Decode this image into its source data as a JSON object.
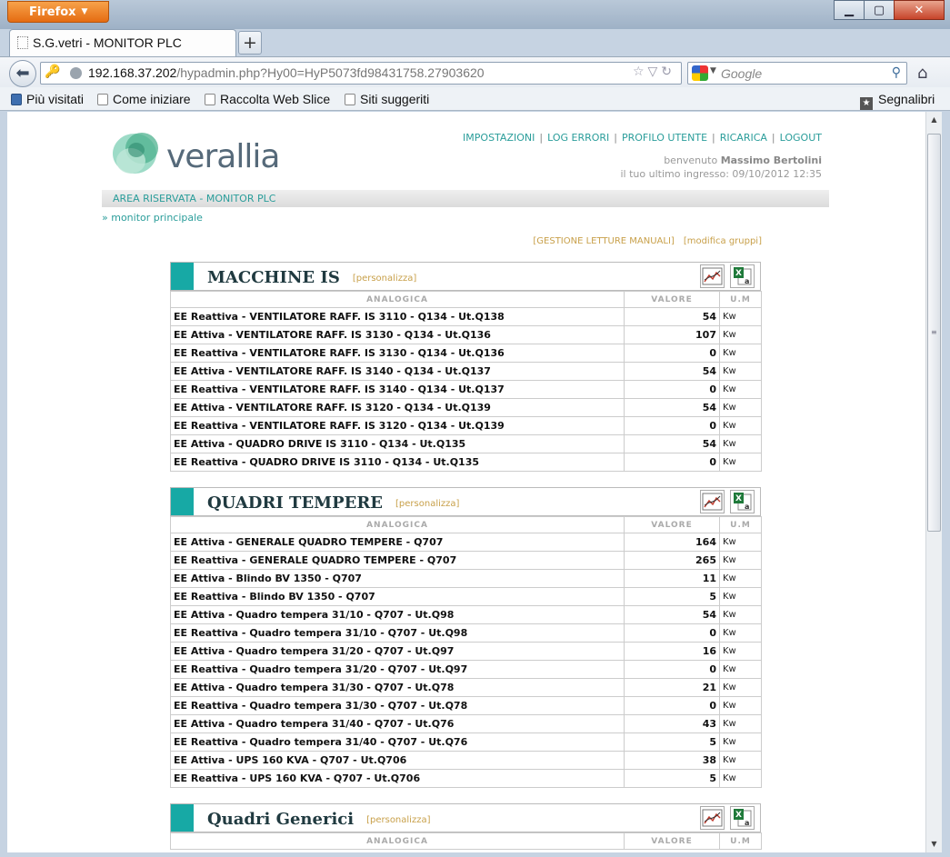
{
  "browser": {
    "menu_label": "Firefox",
    "tab_title": "S.G.vetri - MONITOR PLC",
    "url_host": "192.168.37.202",
    "url_path": "/hypadmin.php?Hy00=HyP5073fd98431758.27903620",
    "search_placeholder": "Google",
    "bookmarks": [
      "Più visitati",
      "Come iniziare",
      "Raccolta Web Slice",
      "Siti suggeriti"
    ],
    "bookmarks_menu": "Segnalibri"
  },
  "header": {
    "logo_text": "verallia",
    "links": [
      "IMPOSTAZIONI",
      "LOG ERRORI",
      "PROFILO UTENTE",
      "RICARICA",
      "LOGOUT"
    ],
    "welcome_prefix": "benvenuto",
    "user_name": "Massimo Bertolini",
    "last_login": "il tuo ultimo ingresso: 09/10/2012 12:35",
    "area_title": "AREA RISERVATA - MONITOR PLC",
    "breadcrumb": "» monitor principale"
  },
  "actions": {
    "manual_readings": "[GESTIONE LETTURE MANUALI]",
    "edit_groups": "[modifica gruppi]"
  },
  "table_headers": {
    "label": "ANALOGICA",
    "value": "VALORE",
    "unit": "U.M"
  },
  "sections": [
    {
      "title": "MACCHINE IS",
      "customize": "[personalizza]",
      "rows": [
        [
          "EE Reattiva - VENTILATORE RAFF. IS 3110 - Q134 - Ut.Q138",
          "54",
          "Kw"
        ],
        [
          "EE Attiva - VENTILATORE RAFF. IS 3130 - Q134 - Ut.Q136",
          "107",
          "Kw"
        ],
        [
          "EE Reattiva - VENTILATORE RAFF. IS 3130 - Q134 - Ut.Q136",
          "0",
          "Kw"
        ],
        [
          "EE Attiva - VENTILATORE RAFF. IS 3140 - Q134 - Ut.Q137",
          "54",
          "Kw"
        ],
        [
          "EE Reattiva - VENTILATORE RAFF. IS 3140 - Q134 - Ut.Q137",
          "0",
          "Kw"
        ],
        [
          "EE Attiva - VENTILATORE RAFF. IS 3120 - Q134 - Ut.Q139",
          "54",
          "Kw"
        ],
        [
          "EE Reattiva - VENTILATORE RAFF. IS 3120 - Q134 - Ut.Q139",
          "0",
          "Kw"
        ],
        [
          "EE Attiva - QUADRO DRIVE IS 3110 - Q134 - Ut.Q135",
          "54",
          "Kw"
        ],
        [
          "EE Reattiva - QUADRO DRIVE IS 3110 - Q134 - Ut.Q135",
          "0",
          "Kw"
        ]
      ]
    },
    {
      "title": "QUADRI TEMPERE",
      "customize": "[personalizza]",
      "rows": [
        [
          "EE Attiva - GENERALE QUADRO TEMPERE - Q707",
          "164",
          "Kw"
        ],
        [
          "EE Reattiva - GENERALE QUADRO TEMPERE - Q707",
          "265",
          "Kw"
        ],
        [
          "EE Attiva - Blindo BV 1350 - Q707",
          "11",
          "Kw"
        ],
        [
          "EE Reattiva - Blindo BV 1350 - Q707",
          "5",
          "Kw"
        ],
        [
          "EE Attiva - Quadro tempera 31/10 - Q707 - Ut.Q98",
          "54",
          "Kw"
        ],
        [
          "EE Reattiva - Quadro tempera 31/10 - Q707 - Ut.Q98",
          "0",
          "Kw"
        ],
        [
          "EE Attiva - Quadro tempera 31/20 - Q707 - Ut.Q97",
          "16",
          "Kw"
        ],
        [
          "EE Reattiva - Quadro tempera 31/20 - Q707 - Ut.Q97",
          "0",
          "Kw"
        ],
        [
          "EE Attiva - Quadro tempera 31/30 - Q707 - Ut.Q78",
          "21",
          "Kw"
        ],
        [
          "EE Reattiva - Quadro tempera 31/30 - Q707 - Ut.Q78",
          "0",
          "Kw"
        ],
        [
          "EE Attiva - Quadro tempera 31/40 - Q707 - Ut.Q76",
          "43",
          "Kw"
        ],
        [
          "EE Reattiva - Quadro tempera 31/40 - Q707 - Ut.Q76",
          "5",
          "Kw"
        ],
        [
          "EE Attiva - UPS 160 KVA - Q707 - Ut.Q706",
          "38",
          "Kw"
        ],
        [
          "EE Reattiva - UPS 160 KVA - Q707 - Ut.Q706",
          "5",
          "Kw"
        ]
      ]
    },
    {
      "title": "Quadri Generici",
      "customize": "[personalizza]",
      "rows": []
    }
  ]
}
